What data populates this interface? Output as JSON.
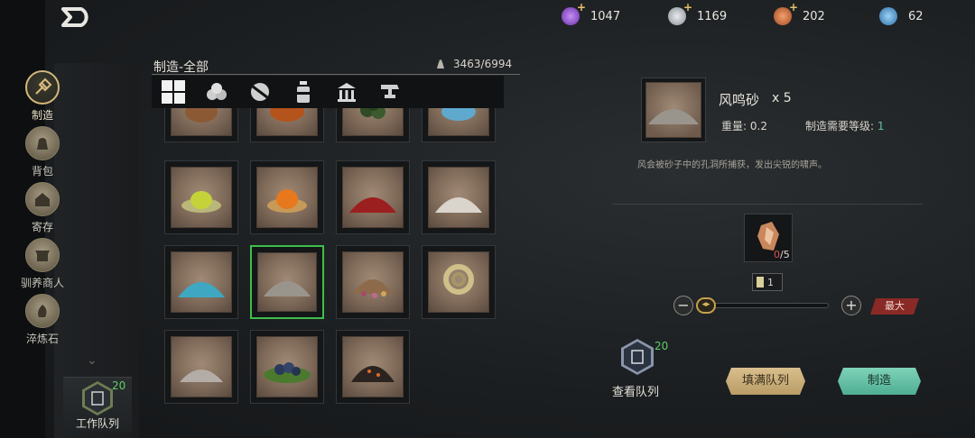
{
  "resources": [
    {
      "name": "purple-gem",
      "value": "1047",
      "color": "#8b4bd6",
      "has_plus": true
    },
    {
      "name": "silver-coin",
      "value": "1169",
      "color": "#b9bec4",
      "has_plus": true
    },
    {
      "name": "bronze-token",
      "value": "202",
      "color": "#d56c3a",
      "has_plus": true
    },
    {
      "name": "blue-orb",
      "value": "62",
      "color": "#3d8fd1",
      "has_plus": false
    }
  ],
  "sidebar": {
    "items": [
      {
        "label": "制造",
        "icon": "hammer-icon"
      },
      {
        "label": "背包",
        "icon": "bag-icon"
      },
      {
        "label": "寄存",
        "icon": "storage-house-icon"
      },
      {
        "label": "驯养商人",
        "icon": "merchant-stall-icon"
      },
      {
        "label": "淬炼石",
        "icon": "stone-icon"
      }
    ],
    "work_queue": {
      "label": "工作队列",
      "count": "20"
    }
  },
  "craft": {
    "title": "制造-全部",
    "weight": "3463/6994",
    "filter_tabs": [
      "all-grid-icon",
      "logs-icon",
      "ore-icon",
      "potion-icon",
      "building-icon",
      "anvil-icon"
    ]
  },
  "detail": {
    "name": "风鸣砂",
    "qty": "x 5",
    "weight_label": "重量:",
    "weight_value": "0.2",
    "level_label": "制造需要等级:",
    "level_value": "1",
    "description": "风会被砂子中的孔洞所捕获，发出尖锐的啸声。",
    "material_have": "0",
    "material_need": "/5",
    "craft_count": "1",
    "minus": "−",
    "plus": "+",
    "max_label": "最大",
    "queue_label": "查看队列",
    "queue_count": "20",
    "fill_queue_label": "填满队列",
    "craft_label": "制造"
  },
  "colors": {
    "selected_border": "#3dbf4a",
    "craft_button": "#5fbfa3",
    "fill_button": "#c8ad78",
    "max_button": "#8a2a26"
  }
}
